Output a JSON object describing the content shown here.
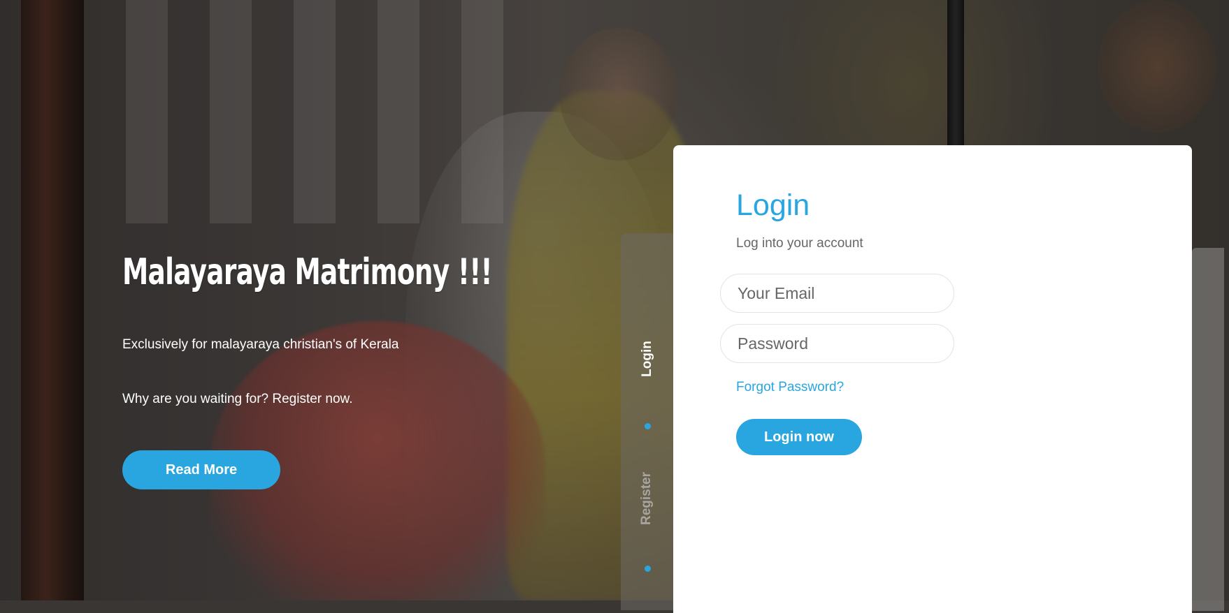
{
  "hero": {
    "title": "Malayaraya Matrimony !!!",
    "subtitle": "Exclusively for malayaraya christian's of Kerala",
    "cta_text": "Why are you waiting for? Register now.",
    "read_more_label": "Read More"
  },
  "tabs": {
    "login_label": "Login",
    "register_label": "Register",
    "active": "Login"
  },
  "login_card": {
    "title": "Login",
    "subtitle": "Log into your account",
    "email_placeholder": "Your Email",
    "email_value": "",
    "password_placeholder": "Password",
    "password_value": "",
    "forgot_label": "Forgot Password?",
    "submit_label": "Login now"
  },
  "colors": {
    "accent": "#29a6df",
    "card_bg": "#ffffff",
    "muted_text": "#666666"
  }
}
